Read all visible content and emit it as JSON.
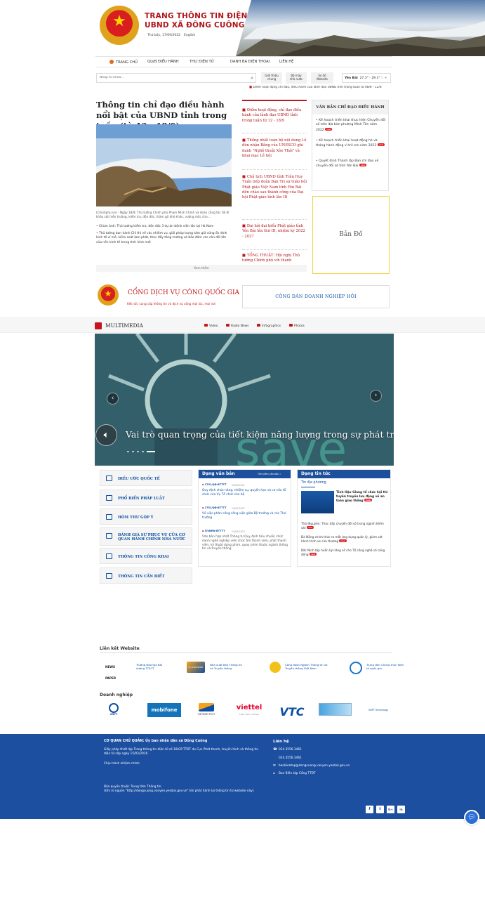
{
  "header": {
    "title_line1": "TRANG THÔNG TIN ĐIỆN TỬ",
    "title_line2": "UBND XÃ ĐÔNG CUÔNG",
    "date": "Thứ bảy, 17/09/2022",
    "language": "English"
  },
  "nav": {
    "items": [
      "TRANG CHỦ",
      "QLVB ĐIỀU HÀNH",
      "THƯ ĐIỆN TỬ",
      "DANH BẠ ĐIỆN THOẠI",
      "LIÊN HỆ"
    ]
  },
  "search": {
    "placeholder": "Nhập từ khóa..."
  },
  "quick_links": [
    {
      "line1": "Giới thiệu",
      "line2": "chung"
    },
    {
      "line1": "Bộ máy",
      "line2": "nhà nước"
    },
    {
      "line1": "Sơ đồ",
      "line2": "Website"
    }
  ],
  "weather": {
    "location": "Yên Bái",
    "temp": "27.3° - 29.3°"
  },
  "ticker": "Điểm hoạt động chỉ đạo, điều hành của lãnh đạo UBND tỉnh trong tuần từ 08/8 - 12/8",
  "feature": {
    "title": "Thông tin chỉ đạo điều hành nổi bật của UBND tỉnh trong tuần (từ 12 - 18/9)",
    "caption": "(Chinhphu.vn) - Ngày 18/9, Thủ tướng Chính phủ Phạm Minh Chính và đoàn công tác đã đi khảo sát hiện trường, kiểm tra, đôn đốc, thăm gỡ khó khăn, vướng mắc cho...",
    "bullets": [
      "Chùm ảnh: Thủ tướng kiểm tra, đôn đốc 3 dự án bệnh viện lớn tại Hà Nam",
      "Thủ tướng ban hành Chỉ thị về các nhiệm vụ, giải pháp trọng tâm giữ vững ổn định kinh tế vĩ mô, kiềm soát lạm phát, thúc đẩy tăng trưởng và bảo đảm các cân đối lớn của nền kinh tế trong tình hình mới"
    ],
    "see_more": "Xem thêm"
  },
  "mid_news": [
    "Điểm hoạt động, chỉ đạo điều hành của lãnh đạo UBND tỉnh trong tuần từ 12 - 18/9",
    "Thống nhất toàn bộ nội dung Lễ đón nhận Bằng của UNESCO ghi danh \"Nghệ thuật Xòe Thái\" và khai mạc Lễ hội",
    "Chủ tịch UBND tỉnh Trần Huy Tuấn tiếp đoàn Ban Trị sự Giáo hội Phật giáo Việt Nam tỉnh Yên Bái đến chào sau thành công của Đại hội Phật giáo tỉnh lần III",
    "Đại hội đại biểu Phật giáo tỉnh Yên Bái lần thứ III, nhiệm kỳ 2022 - 2027",
    "TỔNG THUẬT: Hội nghị Thủ tướng Chính phủ với thanh"
  ],
  "directives": {
    "title": "VĂN BẢN CHỈ ĐẠO ĐIỀU HÀNH",
    "items": [
      "Kế hoạch triển khai thực hiện Chuyển đổi số trên địa bàn phường Minh Tân năm 2022",
      "Kế hoạch triển khai hoạt động hè và tháng hành động vì trẻ em năm 2022",
      "Quyết định Thành lập Ban chỉ đạo về chuyển đổi số tỉnh Yên Bái"
    ],
    "badge": "new"
  },
  "map": {
    "label": "Bản Đồ"
  },
  "public_service": {
    "title": "CỔNG DỊCH VỤ CÔNG QUỐC GIA",
    "subtitle": "Kết nối, cung cấp thông tin và dịch vụ công mọi lúc, mọi nơi"
  },
  "qa": {
    "label": "CÔNG DÂN DOANH NGHIỆP HỎI"
  },
  "multimedia": {
    "title": "MULTIMEDIA",
    "tabs": [
      "Video",
      "Radio News",
      "Infographics",
      "Photos"
    ],
    "slide_caption": "Vai trò quan trọng của tiết kiệm năng lượng trong sự phát triển",
    "slide_word": "save"
  },
  "side_menu": [
    "ĐIỀU ƯỚC QUỐC TẾ",
    "PHỔ BIẾN PHÁP LUẬT",
    "HÒM THƯ GÓP Ý",
    "ĐÁNH GIÁ SỰ PHỤC VỤ CỦA CƠ QUAN HÀNH CHÍNH NHÀ NƯỚC",
    "THÔNG TIN CÔNG KHAI",
    "THÔNG TIN CẦN BIẾT"
  ],
  "documents": {
    "title": "Dạng văn bản",
    "search_label": "Tìm kiếm văn bản",
    "items": [
      {
        "number": "1751/QĐ-BTTTT",
        "date": "26/09/2022",
        "desc": "Quy định chức năng, nhiệm vụ, quyền hạn và cơ cấu tổ chức của Vụ Tổ chức cán bộ"
      },
      {
        "number": "1751/QĐ-BTTTT",
        "date": "19/09/2022",
        "desc": "Về việc phân công công việc giữa Bộ trưởng và các Thứ trưởng"
      },
      {
        "number": "5/VBHN-BTTTT",
        "date": "24/08/2022",
        "desc": "Văn bản hợp nhất Thông tư Quy định tiêu chuẩn chức danh nghề nghiệp viên chức âm thanh viên, phát thanh viên, kỹ thuật dựng phim, quay phim thuộc ngành thông tin và truyền thông"
      }
    ]
  },
  "news": {
    "title": "Dạng tin tức",
    "subtitle": "Tin địa phương",
    "featured": "Tỉnh Hậu Giang tổ chức hội thi tuyên truyền lưu động về an toàn giao thông",
    "items": [
      "Thái Nguyên: Thúc đẩy chuyển đổi số trong ngành Kiểm sát",
      "Đà Nẵng chính thức ra mắt ứng dụng quản lý, giám sát hành trình xe cứu thương",
      "Bắc Ninh tập huấn kỹ năng số cho Tổ công nghệ số cộng đồng"
    ]
  },
  "links": {
    "title": "Liên kết Website",
    "items": [
      {
        "logo": "NEWS PAPER",
        "text": "Trường Đào tạo Bồi dưỡng TT&TT"
      },
      {
        "logo": "IC PUBLISHER",
        "text": "Nhà xuất bản Thông tin và Truyền thông"
      },
      {
        "logo": "union-logo",
        "text": "Công đoàn Ngành Thông tin và Truyền thông Việt Nam"
      },
      {
        "logo": "globe-logo",
        "text": "Trung tâm Chứng thực điện tử quốc gia"
      }
    ]
  },
  "business": {
    "title": "Doanh nghiệp",
    "logos": [
      "VNPT",
      "mobifone",
      "VIETNAM POST",
      "viettel",
      "VTC",
      "partner",
      "VNPT Technology"
    ],
    "viettel_tagline": "Theo cách của bạn"
  },
  "footer": {
    "org": "CƠ QUAN CHỦ QUẢN: Ủy ban nhân dân xã Đông Cuông",
    "license": "Giấy phép thiết lập Trang thông tin điện tử số 18/GP-TTĐT do Cục Phát thanh, truyền hình và thông tin điện tử cấp ngày 15/03/2016.",
    "responsible": "Chịu trách nhiệm chính:",
    "copyright": "Bản quyền thuộc Trung tâm Thông tin.\n(Ghi rõ nguồn \"http://dongcuong.vanyen.yenbai.gov.vn\" khi phát hành lại thông tin từ website này)",
    "contact_title": "Liên hệ",
    "phone1": "024.3556.3461",
    "phone2": "024.3556.3461",
    "email": "banbientap@dongcuong.vanyen.yenbai.gov.vn",
    "editorial": "Ban Biên tập Cổng TTĐT",
    "social": [
      "f",
      "t",
      "G+",
      "in"
    ]
  },
  "colors": {
    "brand_red": "#c4161c",
    "brand_blue": "#1d4fa0",
    "link_blue": "#0d4fa3"
  }
}
